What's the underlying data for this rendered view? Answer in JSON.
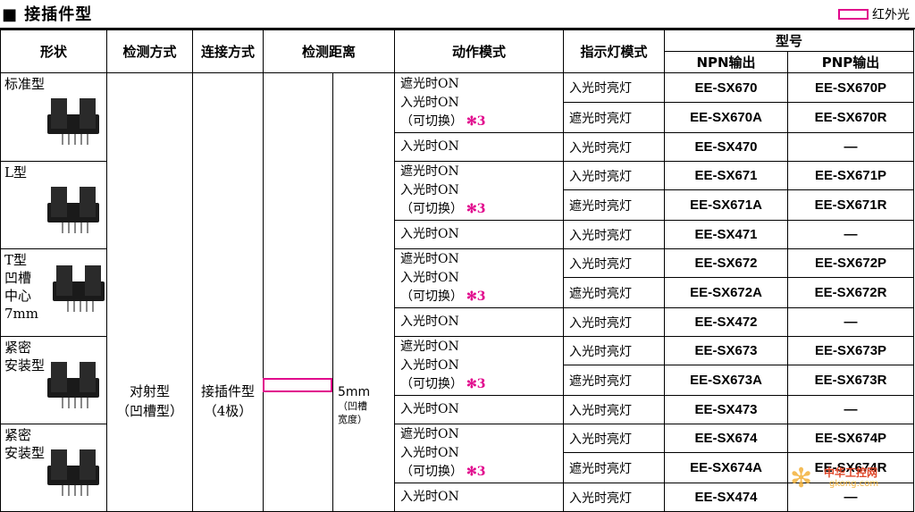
{
  "section_title": "■ 接插件型",
  "legend_label": "红外光",
  "legend_color": "#e1058c",
  "headers": {
    "shape": "形状",
    "detect_method": "检测方式",
    "connect_method": "连接方式",
    "distance": "检测距离",
    "action_mode": "动作模式",
    "indicator_mode": "指示灯模式",
    "model": "型号",
    "npn": "NPN输出",
    "pnp": "PNP输出"
  },
  "detect_method_value": "对射型（凹槽型）",
  "detect_method_lines": [
    "对射型",
    "（凹槽型）"
  ],
  "connect_method_lines": [
    "接插件型",
    "（4极）"
  ],
  "distance_value": "5mm",
  "distance_note_lines": [
    "（凹槽",
    "宽度）"
  ],
  "groups": [
    {
      "shape_lines": [
        "标准型"
      ]
    },
    {
      "shape_lines": [
        "L型"
      ]
    },
    {
      "shape_lines": [
        "T型",
        "凹槽",
        "中心",
        "7mm"
      ]
    },
    {
      "shape_lines": [
        "紧密",
        "安装型"
      ]
    },
    {
      "shape_lines": [
        "紧密",
        "安装型"
      ]
    }
  ],
  "switch_mode_lines": [
    "遮光时ON",
    "入光时ON",
    "（可切换）"
  ],
  "switch_star": "✻3",
  "light_on_mode": "入光时ON",
  "rows": [
    {
      "indicator": "入光时亮灯",
      "npn": "EE-SX670",
      "pnp": "EE-SX670P"
    },
    {
      "indicator": "遮光时亮灯",
      "npn": "EE-SX670A",
      "pnp": "EE-SX670R"
    },
    {
      "indicator": "入光时亮灯",
      "npn": "EE-SX470",
      "pnp": "—"
    },
    {
      "indicator": "入光时亮灯",
      "npn": "EE-SX671",
      "pnp": "EE-SX671P"
    },
    {
      "indicator": "遮光时亮灯",
      "npn": "EE-SX671A",
      "pnp": "EE-SX671R"
    },
    {
      "indicator": "入光时亮灯",
      "npn": "EE-SX471",
      "pnp": "—"
    },
    {
      "indicator": "入光时亮灯",
      "npn": "EE-SX672",
      "pnp": "EE-SX672P"
    },
    {
      "indicator": "遮光时亮灯",
      "npn": "EE-SX672A",
      "pnp": "EE-SX672R"
    },
    {
      "indicator": "入光时亮灯",
      "npn": "EE-SX472",
      "pnp": "—"
    },
    {
      "indicator": "入光时亮灯",
      "npn": "EE-SX673",
      "pnp": "EE-SX673P"
    },
    {
      "indicator": "遮光时亮灯",
      "npn": "EE-SX673A",
      "pnp": "EE-SX673R"
    },
    {
      "indicator": "入光时亮灯",
      "npn": "EE-SX473",
      "pnp": "—"
    },
    {
      "indicator": "入光时亮灯",
      "npn": "EE-SX674",
      "pnp": "EE-SX674P"
    },
    {
      "indicator": "遮光时亮灯",
      "npn": "EE-SX674A",
      "pnp": "EE-SX674R"
    },
    {
      "indicator": "入光时亮灯",
      "npn": "EE-SX474",
      "pnp": "—"
    }
  ],
  "watermark": {
    "text": "中华工控网",
    "sub": "gkong.com"
  }
}
